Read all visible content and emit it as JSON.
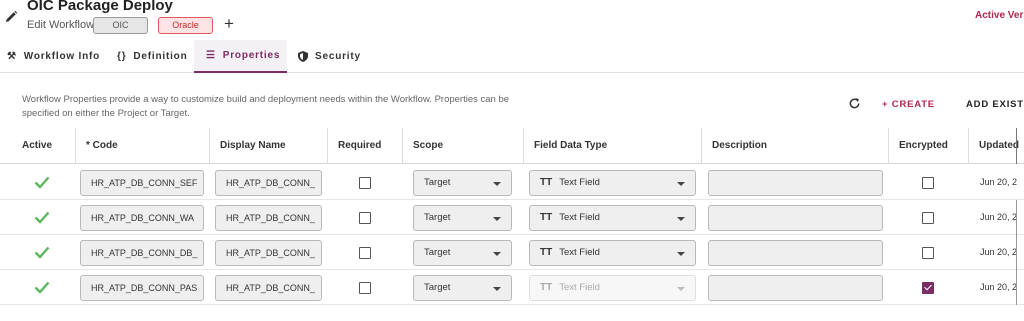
{
  "header": {
    "title": "OIC Package Deploy",
    "edit_label": "Edit Workflow",
    "chips": [
      "OIC",
      "Oracle"
    ],
    "add_symbol": "+",
    "active_version_label": "Active Vers"
  },
  "tabs": [
    {
      "label": "Workflow Info",
      "icon": "tools-icon"
    },
    {
      "label": "Definition",
      "icon": "code-braces-icon"
    },
    {
      "label": "Properties",
      "icon": "list-icon",
      "active": true
    },
    {
      "label": "Security",
      "icon": "shield-icon"
    }
  ],
  "description": "Workflow Properties provide a way to customize build and deployment needs within the Workflow. Properties can be specified on either the Project or Target.",
  "actions": {
    "create": "+ CREATE",
    "add_existing": "ADD EXISTI"
  },
  "columns": [
    "Active",
    "* Code",
    "Display Name",
    "Required",
    "Scope",
    "Field Data Type",
    "Description",
    "Encrypted",
    "Updated"
  ],
  "rows": [
    {
      "code": "HR_ATP_DB_CONN_SEF",
      "display": "HR_ATP_DB_CONN_",
      "scope": "Target",
      "type": "Text Field",
      "type_disabled": false,
      "encrypted": false,
      "updated": "Jun 20, 2"
    },
    {
      "code": "HR_ATP_DB_CONN_WA",
      "display": "HR_ATP_DB_CONN_",
      "scope": "Target",
      "type": "Text Field",
      "type_disabled": false,
      "encrypted": false,
      "updated": "Jun 20, 2"
    },
    {
      "code": "HR_ATP_DB_CONN_DB_",
      "display": "HR_ATP_DB_CONN_",
      "scope": "Target",
      "type": "Text Field",
      "type_disabled": false,
      "encrypted": false,
      "updated": "Jun 20, 2"
    },
    {
      "code": "HR_ATP_DB_CONN_PAS",
      "display": "HR_ATP_DB_CONN_",
      "scope": "Target",
      "type": "Text Field",
      "type_disabled": true,
      "encrypted": true,
      "updated": "Jun 20, 2"
    }
  ],
  "type_icon_text": "TT",
  "colors": {
    "accent": "#7a2d63",
    "danger": "#b3264d",
    "check": "#5cb85c"
  }
}
